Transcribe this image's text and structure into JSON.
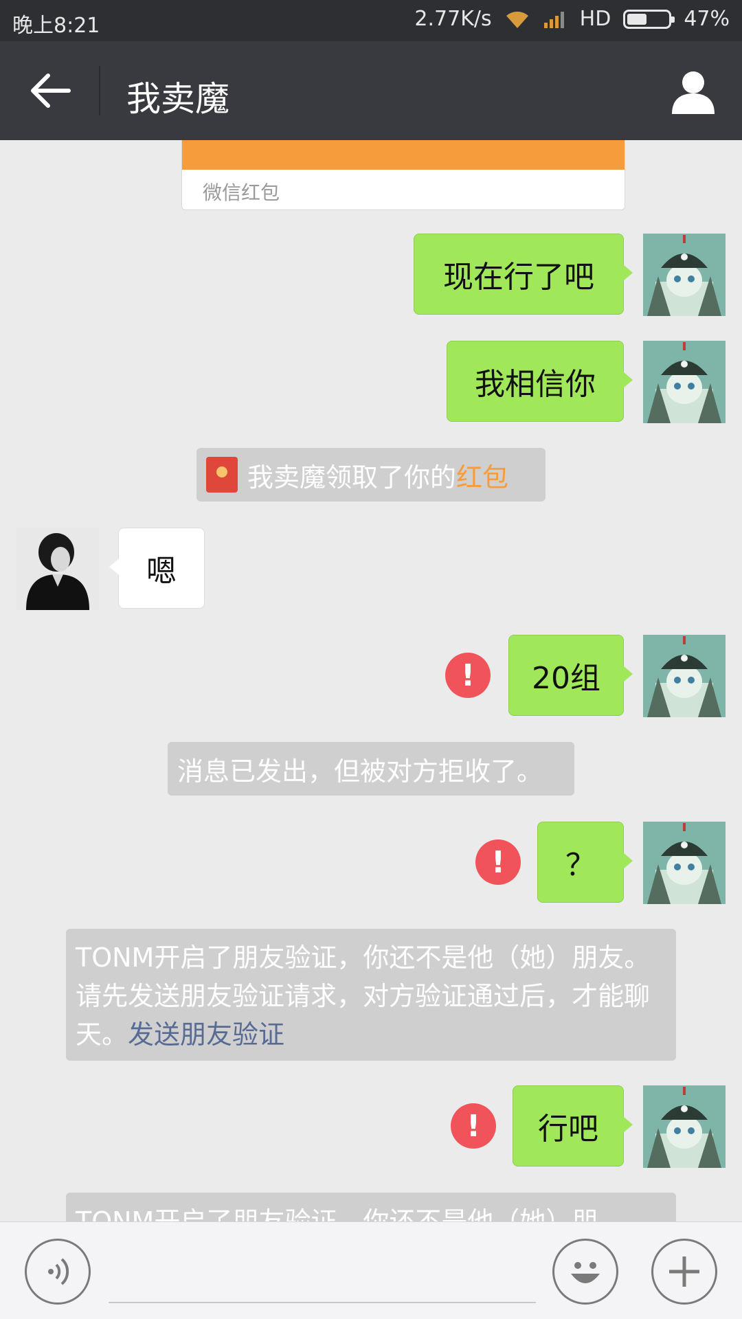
{
  "status_bar": {
    "time": "晚上8:21",
    "speed": "2.77K/s",
    "network": "HD",
    "battery": "47%",
    "battery_level": 0.47
  },
  "header": {
    "title": "我卖魔"
  },
  "red_packet_card": {
    "label": "微信红包"
  },
  "messages": {
    "m1": "现在行了吧",
    "m2": "我相信你",
    "sys_packet_prefix": "我卖魔领取了你的",
    "sys_packet_highlight": "红包",
    "incoming": "嗯",
    "m3": "20组",
    "sys_rejected": "消息已发出，但被对方拒收了。",
    "m4": "？",
    "sys_verify_text": "TONM开启了朋友验证，你还不是他（她）朋友。请先发送朋友验证请求，对方验证通过后，才能聊天。",
    "sys_verify_link": "发送朋友验证",
    "m5": "行吧",
    "sys_verify_text_partial": "TONM开启了朋友验证，你还不是他（她）朋"
  },
  "icons": {
    "back": "arrow-left-icon",
    "profile": "person-icon",
    "voice": "voice-icon",
    "emoji": "emoji-icon",
    "more": "plus-icon",
    "warning": "exclamation-icon"
  },
  "colors": {
    "accent_green": "#a0e75a",
    "warning_red": "#f0545a",
    "packet_orange": "#f79c3c",
    "link_blue": "#576b95"
  }
}
